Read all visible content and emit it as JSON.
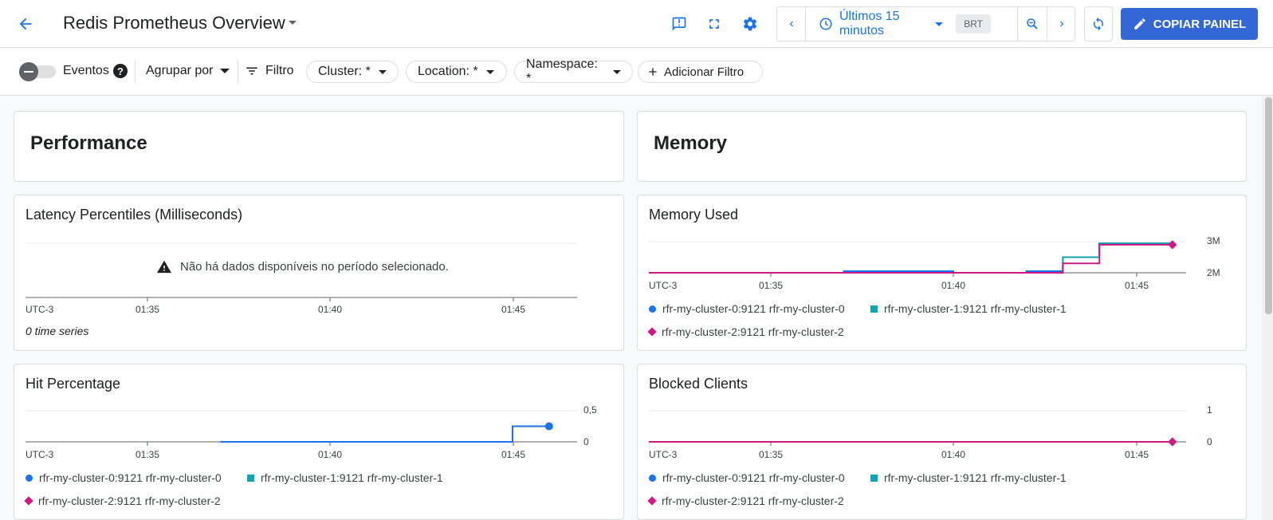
{
  "header": {
    "title": "Redis Prometheus Overview",
    "time_range": "Últimos 15 minutos",
    "timezone_badge": "BRT",
    "copy_button": "COPIAR PAINEL"
  },
  "filters": {
    "events_label": "Eventos",
    "group_by_label": "Agrupar por",
    "filter_label": "Filtro",
    "chips": [
      "Cluster: *",
      "Location: *",
      "Namespace: *"
    ],
    "add_filter": "Adicionar Filtro"
  },
  "sections": {
    "performance": "Performance",
    "memory": "Memory"
  },
  "colors": {
    "series0": "#1a73e8",
    "series1": "#12a4af",
    "series2": "#d01884",
    "accent": "#3367d6"
  },
  "axis_timezone": "UTC-3",
  "x_ticks": [
    "01:35",
    "01:40",
    "01:45"
  ],
  "legend": [
    {
      "label": "rfr-my-cluster-0:9121 rfr-my-cluster-0",
      "shape": "circle",
      "color": "#1a73e8"
    },
    {
      "label": "rfr-my-cluster-1:9121 rfr-my-cluster-1",
      "shape": "square",
      "color": "#12a4af"
    },
    {
      "label": "rfr-my-cluster-2:9121 rfr-my-cluster-2",
      "shape": "diamond",
      "color": "#d01884"
    }
  ],
  "charts": {
    "latency": {
      "title": "Latency Percentiles (Milliseconds)",
      "no_data": "Não há dados disponíveis no período selecionado.",
      "series_count": "0 time series"
    },
    "memory_used": {
      "title": "Memory Used",
      "y_ticks": [
        "3M",
        "2M"
      ]
    },
    "hit_percentage": {
      "title": "Hit Percentage",
      "y_ticks": [
        "0,5",
        "0"
      ]
    },
    "blocked_clients": {
      "title": "Blocked Clients",
      "y_ticks": [
        "1",
        "0"
      ]
    }
  },
  "chart_data": [
    {
      "type": "line",
      "title": "Memory Used",
      "x": [
        "01:33",
        "01:35",
        "01:37",
        "01:38",
        "01:40",
        "01:42",
        "01:43",
        "01:44",
        "01:45",
        "01:46"
      ],
      "ylim": [
        2000000,
        3000000
      ],
      "series": [
        {
          "name": "rfr-my-cluster-0:9121 rfr-my-cluster-0",
          "values": [
            2000000,
            2000000,
            2050000,
            2050000,
            2000000,
            2050000,
            2500000,
            2950000,
            2950000,
            2950000
          ]
        },
        {
          "name": "rfr-my-cluster-1:9121 rfr-my-cluster-1",
          "values": [
            2000000,
            2000000,
            2000000,
            2000000,
            2000000,
            2000000,
            2500000,
            2950000,
            2950000,
            2950000
          ]
        },
        {
          "name": "rfr-my-cluster-2:9121 rfr-my-cluster-2",
          "values": [
            2000000,
            2000000,
            2000000,
            2000000,
            2000000,
            2000000,
            2300000,
            2900000,
            2900000,
            2900000
          ]
        }
      ]
    },
    {
      "type": "line",
      "title": "Hit Percentage",
      "x": [
        "01:37",
        "01:40",
        "01:45",
        "01:45",
        "01:46"
      ],
      "ylim": [
        0,
        0.5
      ],
      "series": [
        {
          "name": "rfr-my-cluster-0:9121 rfr-my-cluster-0",
          "values": [
            0,
            0,
            0,
            0.25,
            0.25
          ]
        }
      ]
    },
    {
      "type": "line",
      "title": "Blocked Clients",
      "x": [
        "01:33",
        "01:46"
      ],
      "ylim": [
        0,
        1
      ],
      "series": [
        {
          "name": "rfr-my-cluster-2:9121 rfr-my-cluster-2",
          "values": [
            0,
            0
          ]
        }
      ]
    }
  ]
}
